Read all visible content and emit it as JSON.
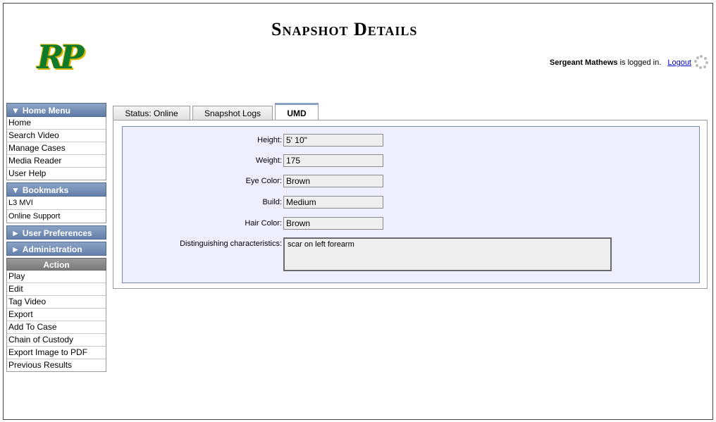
{
  "header": {
    "logo_text": "RP",
    "page_title": "Snapshot Details",
    "logged_in_user": "Sergeant Mathews",
    "logged_in_suffix": "is logged in.",
    "logout_label": "Logout"
  },
  "sidebar": {
    "home_menu": {
      "title": "Home Menu",
      "items": [
        "Home",
        "Search Video",
        "Manage Cases",
        "Media Reader",
        "User Help"
      ]
    },
    "bookmarks": {
      "title": "Bookmarks",
      "items": [
        "L3 MVI",
        "Online Support"
      ]
    },
    "user_preferences": {
      "title": "User Preferences"
    },
    "administration": {
      "title": "Administration"
    },
    "action": {
      "title": "Action",
      "items": [
        "Play",
        "Edit",
        "Tag Video",
        "Export",
        "Add To Case",
        "Chain of Custody",
        "Export Image to PDF",
        "Previous Results"
      ]
    }
  },
  "tabs": [
    "Status: Online",
    "Snapshot Logs",
    "UMD"
  ],
  "active_tab": "UMD",
  "umd": {
    "height_label": "Height:",
    "height": "5' 10\"",
    "weight_label": "Weight:",
    "weight": "175",
    "eye_color_label": "Eye Color:",
    "eye_color": "Brown",
    "build_label": "Build:",
    "build": "Medium",
    "hair_color_label": "Hair Color:",
    "hair_color": "Brown",
    "distinguishing_label": "Distinguishing characteristics:",
    "distinguishing": "scar on left forearm"
  },
  "colors": {
    "logo_green": "#0f7a2c",
    "logo_gold": "#d9b400",
    "menu_blue": "#6480ab",
    "panel_bg": "#eeeeff",
    "link": "#0000cc"
  }
}
